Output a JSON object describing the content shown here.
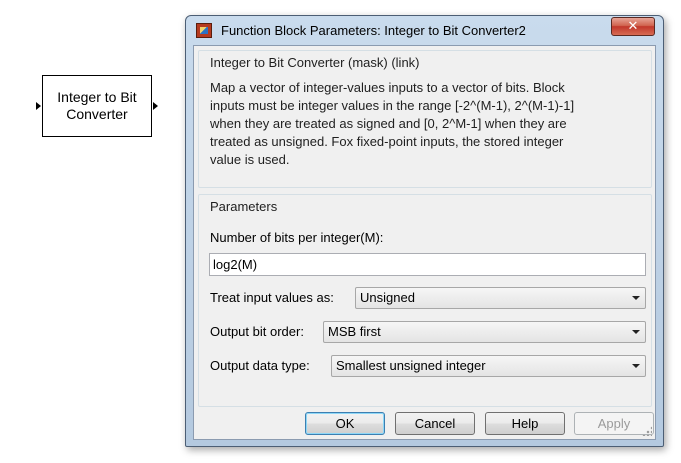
{
  "background_block": {
    "label_line1": "Integer to Bit",
    "label_line2": "Converter"
  },
  "window": {
    "title": "Function Block Parameters: Integer to Bit Converter2",
    "close_glyph": "✕"
  },
  "description_group": {
    "title": "Integer to Bit Converter (mask) (link)",
    "lines": [
      "Map a vector of integer-values inputs to a vector of bits.  Block",
      "inputs must be integer values in the range [-2^(M-1), 2^(M-1)-1]",
      "when they are treated as signed and [0, 2^M-1] when they are",
      "treated as unsigned.  Fox fixed-point inputs, the stored integer",
      "value is used."
    ]
  },
  "parameters_group": {
    "title": "Parameters",
    "bits_label": "Number of bits per integer(M):",
    "bits_value": "log2(M)",
    "treat_label": "Treat input values as:",
    "treat_value": "Unsigned",
    "order_label": "Output bit order:",
    "order_value": "MSB first",
    "dtype_label": "Output data type:",
    "dtype_value": "Smallest unsigned integer"
  },
  "buttons": {
    "ok": "OK",
    "cancel": "Cancel",
    "help": "Help",
    "apply": "Apply"
  }
}
